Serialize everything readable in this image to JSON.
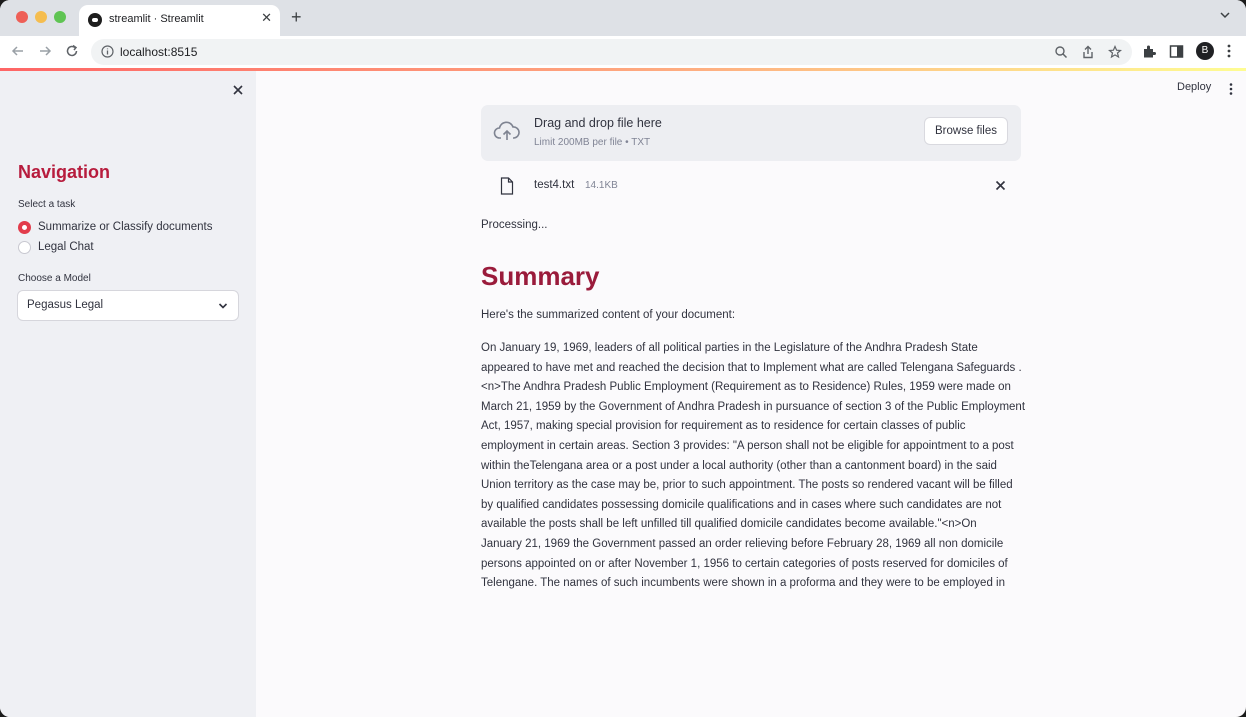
{
  "browser": {
    "tab_title": "streamlit · Streamlit",
    "url": "localhost:8515",
    "profile_initial": "B"
  },
  "sidebar": {
    "heading": "Navigation",
    "task_label": "Select a task",
    "tasks": [
      {
        "label": "Summarize or Classify documents",
        "selected": true
      },
      {
        "label": "Legal Chat",
        "selected": false
      }
    ],
    "model_label": "Choose a Model",
    "model_value": "Pegasus Legal"
  },
  "header": {
    "deploy_label": "Deploy"
  },
  "uploader": {
    "title": "Drag and drop file here",
    "subtitle": "Limit 200MB per file • TXT",
    "browse_label": "Browse files",
    "file_name": "test4.txt",
    "file_size": "14.1KB"
  },
  "status": {
    "processing": "Processing..."
  },
  "summary": {
    "title": "Summary",
    "intro": "Here's the summarized content of your document:",
    "lines": [
      "On January 19, 1969, leaders of all political parties in the Legislature of the Andhra Pradesh State",
      "appeared to have met and reached the decision that to Implement what are called Telengana Safeguards .",
      "<n>The Andhra Pradesh Public Employment (Requirement as to Residence) Rules, 1959 were made on",
      "March 21, 1959 by the Government of Andhra Pradesh in pursuance of section 3 of the Public Employment",
      "Act, 1957, making special provision for requirement as to residence for certain classes of public",
      "employment in certain areas. Section 3 provides: \"A person shall not be eligible for appointment to a post",
      "within theTelengana area or a post under a local authority (other than a cantonment board) in the said",
      "Union territory as the case may be, prior to such appointment. The posts so rendered vacant will be filled",
      "by qualified candidates possessing domicile qualifications and in cases where such candidates are not",
      "available the posts shall be left unfilled till qualified domicile candidates become available.\"<n>On",
      "January 21, 1969 the Government passed an order relieving before February 28, 1969 all non domicile",
      "persons appointed on or after November 1, 1956 to certain categories of posts reserved for domiciles of",
      "Telengane. The names of such incumbents were shown in a proforma and they were to be employed in"
    ]
  },
  "colors": {
    "accent": "#e23c4b",
    "heading": "#b71c3d",
    "summary_title": "#9a1b3b",
    "sidebar_bg": "#eff0f4"
  }
}
